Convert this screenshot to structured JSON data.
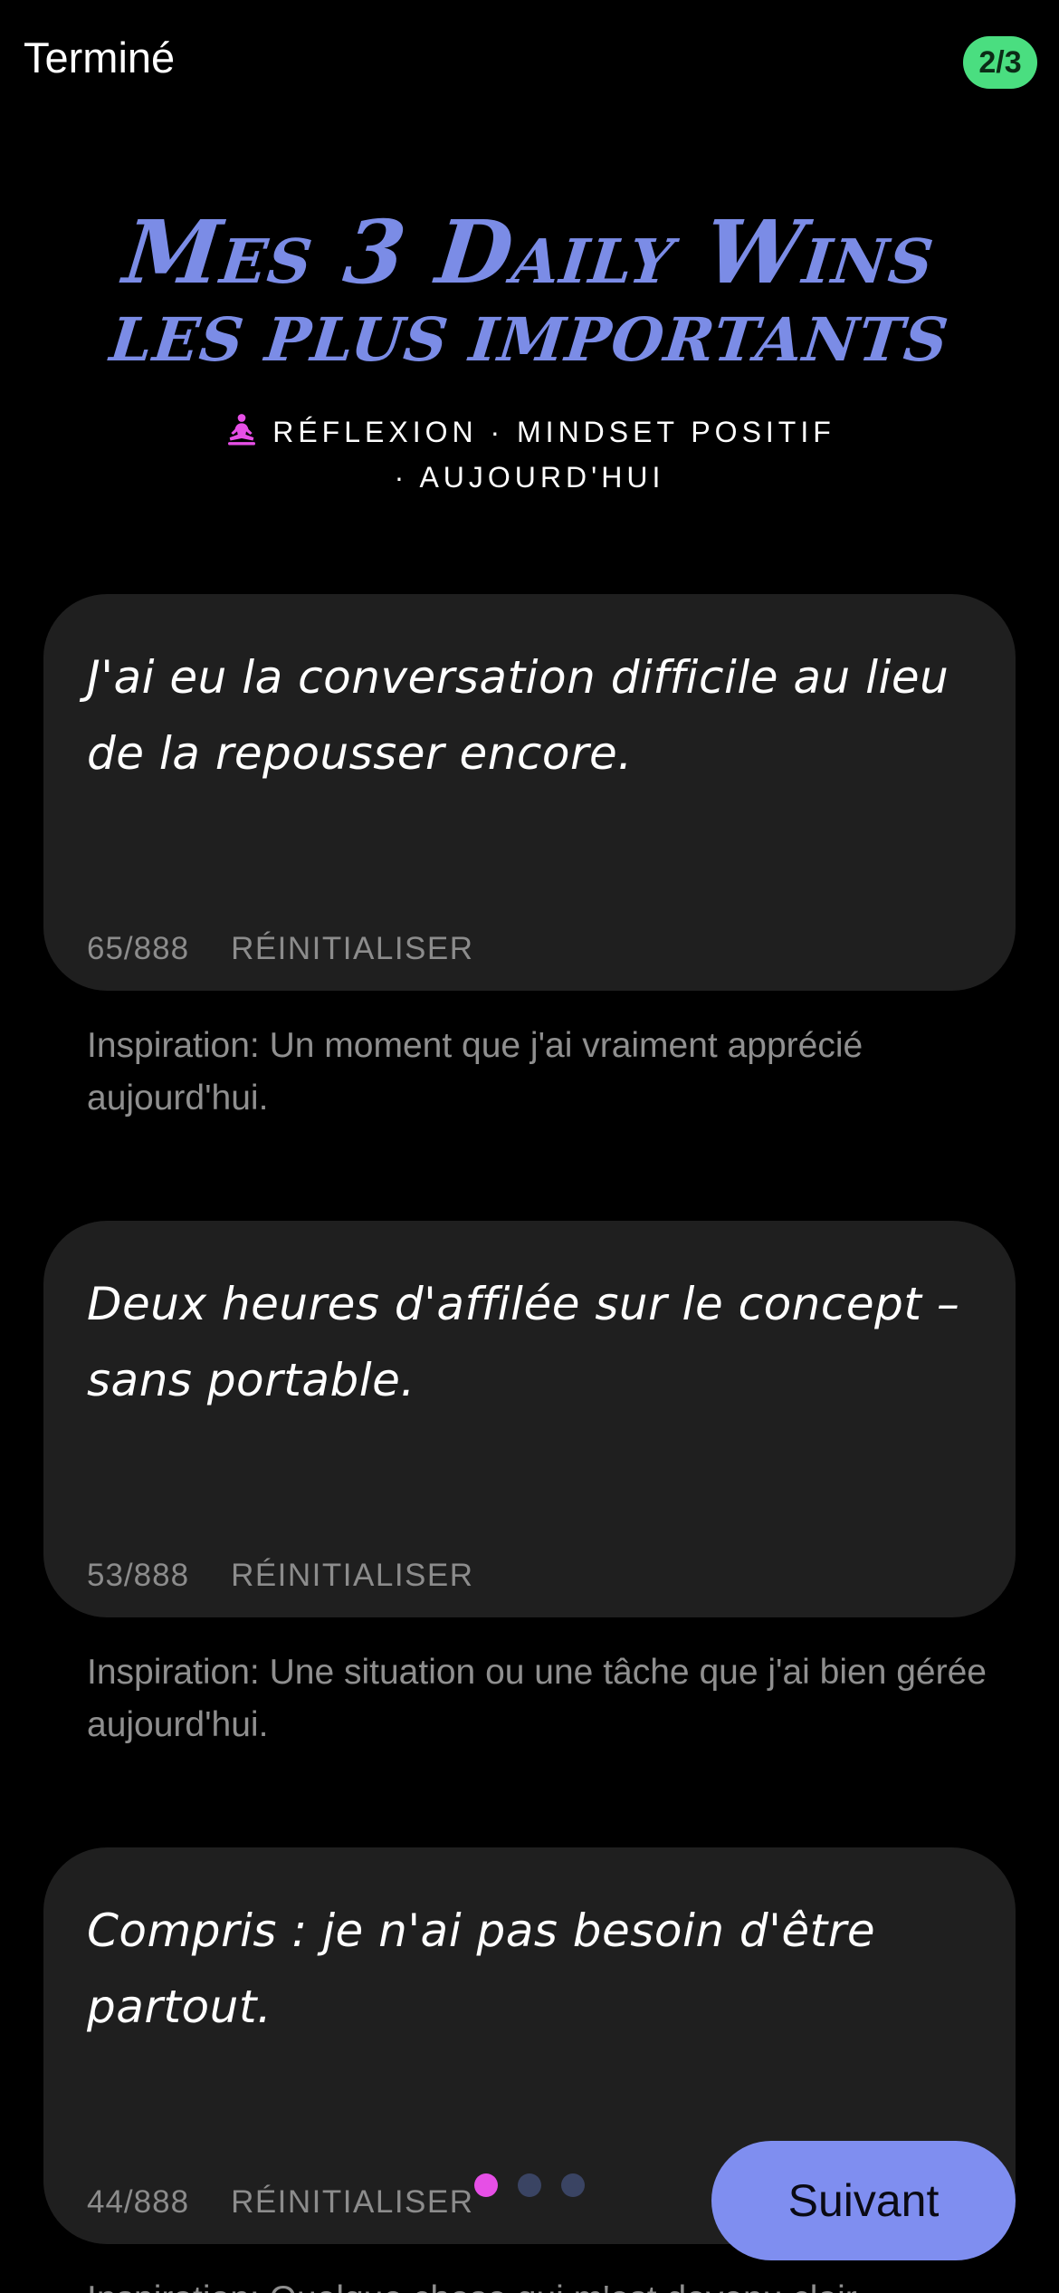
{
  "header": {
    "done_label": "Terminé",
    "step_badge": "2/3"
  },
  "title": {
    "line1": "Mes 3 Daily Wins",
    "line2": "les plus importants"
  },
  "subtitle": {
    "line1": "RÉFLEXION · MINDSET POSITIF",
    "line2": "· AUJOURD'HUI",
    "icon": "meditation-icon"
  },
  "wins": [
    {
      "text": "J'ai eu la conversation difficile au lieu de la repousser encore.",
      "counter": "65/888",
      "reset_label": "RÉINITIALISER",
      "inspiration": "Inspiration: Un moment que j'ai vraiment apprécié aujourd'hui."
    },
    {
      "text": "Deux heures d'affilée sur le concept – sans portable.",
      "counter": "53/888",
      "reset_label": "RÉINITIALISER",
      "inspiration": "Inspiration: Une situation ou une tâche que j'ai bien gérée aujourd'hui."
    },
    {
      "text": "Compris : je n'ai pas besoin d'être partout.",
      "counter": "44/888",
      "reset_label": "RÉINITIALISER",
      "inspiration": "Inspiration: Quelque chose qui m'est devenu clair"
    }
  ],
  "pager": {
    "total": 3,
    "active_index": 0
  },
  "next_label": "Suivant",
  "colors": {
    "background": "#000000",
    "card": "#1f1f1f",
    "title": "#7b8ce6",
    "badge": "#4ade80",
    "dot_active": "#e64fe6",
    "dot_inactive": "#3a4463",
    "next_button": "#7f8ef0"
  }
}
